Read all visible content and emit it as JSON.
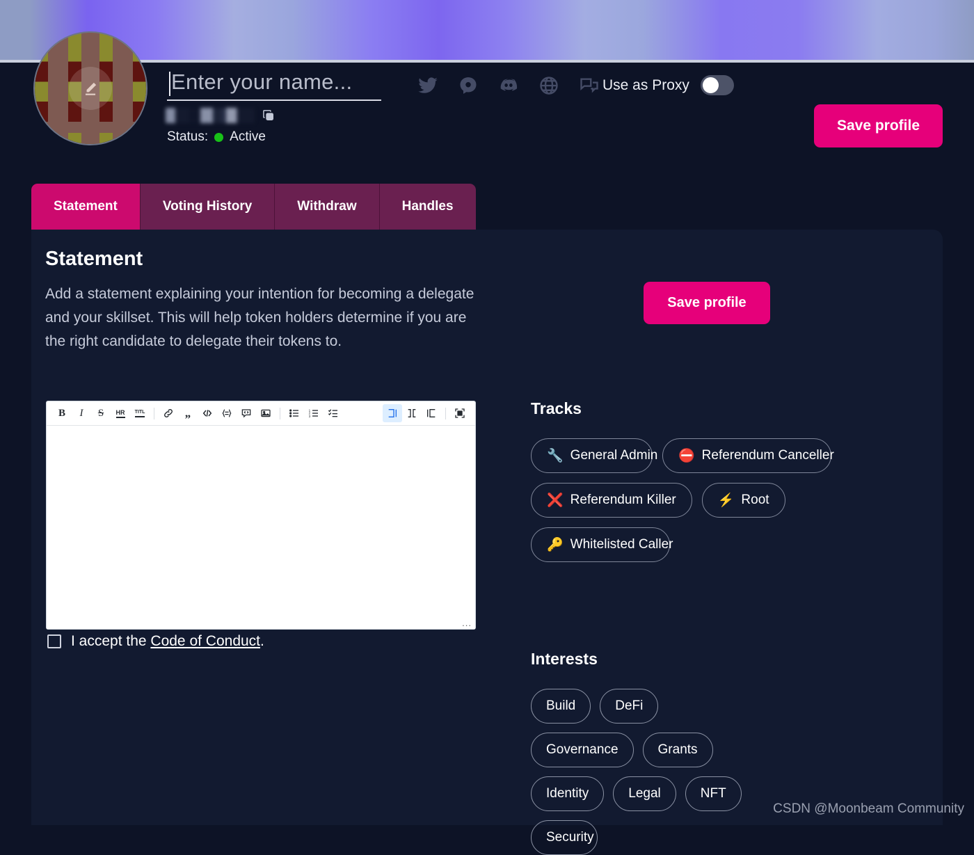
{
  "banner": {
    "alt": "profile-cover-gradient"
  },
  "profile": {
    "avatar_alt": "identicon-avatar",
    "edit_icon": "pencil-icon",
    "name_placeholder": "Enter your name...",
    "name_value": "",
    "address_masked": "",
    "copy_icon": "copy-icon",
    "status_label": "Status:",
    "status_value": "Active",
    "status_color": "#18c118"
  },
  "socials": [
    {
      "name": "twitter-icon",
      "label": "Twitter"
    },
    {
      "name": "element-icon",
      "label": "Element"
    },
    {
      "name": "discord-icon",
      "label": "Discord"
    },
    {
      "name": "website-icon",
      "label": "Website"
    },
    {
      "name": "forum-icon",
      "label": "Forum"
    }
  ],
  "proxy": {
    "label": "Use as Proxy",
    "enabled": false
  },
  "buttons": {
    "save_top": "Save profile",
    "save_mid": "Save profile",
    "accent_color": "#e6007a"
  },
  "tabs": [
    {
      "label": "Statement",
      "active": true
    },
    {
      "label": "Voting History",
      "active": false
    },
    {
      "label": "Withdraw",
      "active": false
    },
    {
      "label": "Handles",
      "active": false
    }
  ],
  "statement": {
    "title": "Statement",
    "description": "Add a statement explaining your intention for becoming a delegate and your skillset. This will help token holders determine if you are the right candidate to delegate their tokens to.",
    "editor_value": "",
    "resize_handle": "..."
  },
  "editor_toolbar": {
    "groups": [
      [
        {
          "name": "bold-icon",
          "glyph": "B",
          "label": "Bold",
          "active": false
        },
        {
          "name": "italic-icon",
          "glyph": "I",
          "label": "Italic",
          "active": false
        },
        {
          "name": "strikethrough-icon",
          "glyph": "S",
          "label": "Strikethrough",
          "active": false
        },
        {
          "name": "horizontal-rule-icon",
          "glyph": "HR",
          "label": "Horizontal Rule",
          "active": false
        },
        {
          "name": "title-icon",
          "glyph": "TITL",
          "label": "Title",
          "active": false
        }
      ],
      [
        {
          "name": "link-icon",
          "glyph": "",
          "label": "Link",
          "active": false
        },
        {
          "name": "quote-icon",
          "glyph": "",
          "label": "Quote",
          "active": false
        },
        {
          "name": "code-icon",
          "glyph": "",
          "label": "Code",
          "active": false
        },
        {
          "name": "code-block-icon",
          "glyph": "",
          "label": "Code Block",
          "active": false
        },
        {
          "name": "comment-code-icon",
          "glyph": "",
          "label": "Embed",
          "active": false
        },
        {
          "name": "image-icon",
          "glyph": "",
          "label": "Image",
          "active": false
        }
      ],
      [
        {
          "name": "bullet-list-icon",
          "glyph": "",
          "label": "Unordered List",
          "active": false
        },
        {
          "name": "ordered-list-icon",
          "glyph": "",
          "label": "Ordered List",
          "active": false
        },
        {
          "name": "checklist-icon",
          "glyph": "",
          "label": "Check List",
          "active": false
        }
      ],
      [
        {
          "name": "edit-view-icon",
          "glyph": "",
          "label": "Edit Only",
          "active": true
        },
        {
          "name": "split-view-icon",
          "glyph": "",
          "label": "Split View",
          "active": false
        },
        {
          "name": "preview-view-icon",
          "glyph": "",
          "label": "Preview Only",
          "active": false
        },
        {
          "name": "fullscreen-icon",
          "glyph": "",
          "label": "Fullscreen",
          "active": false
        }
      ]
    ]
  },
  "conduct": {
    "checked": false,
    "text_before": "I accept the ",
    "link": "Code of Conduct",
    "text_after": "."
  },
  "tracks": {
    "title": "Tracks",
    "items": [
      {
        "emoji": "🔧",
        "label": "General Admin"
      },
      {
        "emoji": "⛔",
        "label": "Referendum Canceller"
      },
      {
        "emoji": "❌",
        "label": "Referendum Killer"
      },
      {
        "emoji": "⚡",
        "label": "Root"
      },
      {
        "emoji": "🔑",
        "label": "Whitelisted Caller"
      }
    ]
  },
  "interests": {
    "title": "Interests",
    "items": [
      "Build",
      "DeFi",
      "Governance",
      "Grants",
      "Identity",
      "Legal",
      "NFT",
      "Security"
    ]
  },
  "watermark": "CSDN @Moonbeam Community"
}
